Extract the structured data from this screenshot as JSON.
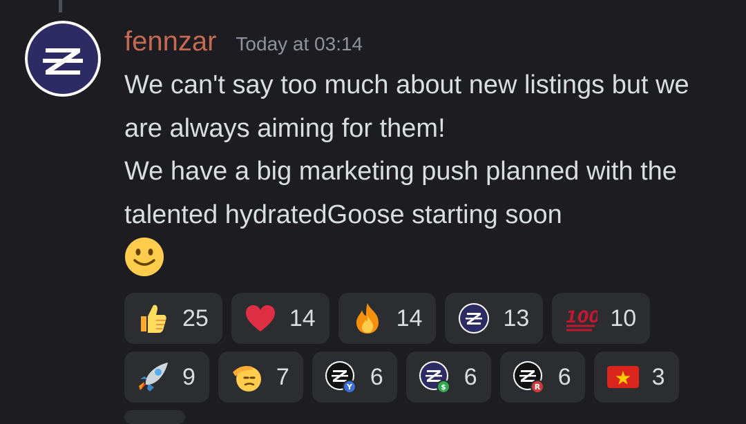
{
  "message": {
    "username": "fennzar",
    "timestamp": "Today at 03:14",
    "lines": [
      "We can't say too much about new listings but we are always aiming for them!",
      "We have a big marketing push planned with the talented hydratedGoose starting soon"
    ],
    "trailing_emoji": "slightly-smiling-face"
  },
  "reactions": {
    "row1": [
      {
        "emoji": "thumbs-up",
        "count": "25"
      },
      {
        "emoji": "red-heart",
        "count": "14"
      },
      {
        "emoji": "fire",
        "count": "14"
      },
      {
        "emoji": "zephyr-logo",
        "count": "13"
      },
      {
        "emoji": "hundred-points",
        "count": "10"
      }
    ],
    "row2": [
      {
        "emoji": "rocket",
        "count": "9"
      },
      {
        "emoji": "saluting-face",
        "count": "7"
      },
      {
        "emoji": "zephyr-y",
        "count": "6"
      },
      {
        "emoji": "zephyr-s",
        "count": "6"
      },
      {
        "emoji": "zephyr-r",
        "count": "6"
      },
      {
        "emoji": "vietnam-flag",
        "count": "3"
      }
    ]
  },
  "colors": {
    "background": "#1c1c21",
    "username": "#c46a52",
    "chip": "#2b2d31",
    "text": "#dbdee1"
  }
}
